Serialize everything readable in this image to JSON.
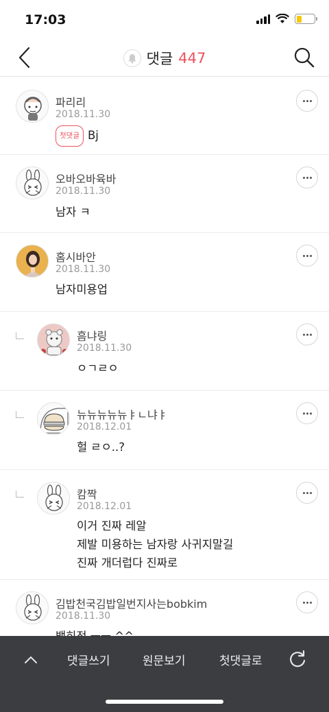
{
  "status_bar": {
    "time": "17:03"
  },
  "nav": {
    "title": "댓글",
    "count": "447"
  },
  "comments": [
    {
      "user": "파리리",
      "date": "2018.11.30",
      "badge": "첫댓글",
      "text": "Bj",
      "reply": false,
      "avatar": "character-face-avatar"
    },
    {
      "user": "오바오바육바",
      "date": "2018.11.30",
      "text": "남자 ㅋ",
      "reply": false,
      "avatar": "bunny-avatar"
    },
    {
      "user": "홈시바안",
      "date": "2018.11.30",
      "text": "남자미용업",
      "reply": false,
      "avatar": "photo-avatar"
    },
    {
      "user": "흠냐링",
      "date": "2018.11.30",
      "text": "ㅇㄱㄹㅇ",
      "reply": true,
      "avatar": "plush-toy-avatar"
    },
    {
      "user": "뉴뉴뉴뉴뉴ㅑㄴ냐ㅑ",
      "date": "2018.12.01",
      "text": "헐 ㄹㅇ..?",
      "reply": true,
      "avatar": "hamburger-avatar"
    },
    {
      "user": "캄짝",
      "date": "2018.12.01",
      "lines": [
        "이거 진짜 레알",
        "제발 미용하는 남자랑 사귀지말길",
        "진짜 개더럽다 진짜로"
      ],
      "reply": true,
      "avatar": "bunny-avatar"
    },
    {
      "user": "김밥천국김밥일번지사는bobkim",
      "date": "2018.11.30",
      "text": "백히적 ㅡㅡ ^^",
      "reply": false,
      "avatar": "bunny-avatar"
    }
  ],
  "bottom_bar": {
    "write": "댓글쓰기",
    "view_original": "원문보기",
    "first_comment": "첫댓글로"
  },
  "colors": {
    "accent": "#e8545b",
    "bottom_bar": "#3c3d41"
  }
}
